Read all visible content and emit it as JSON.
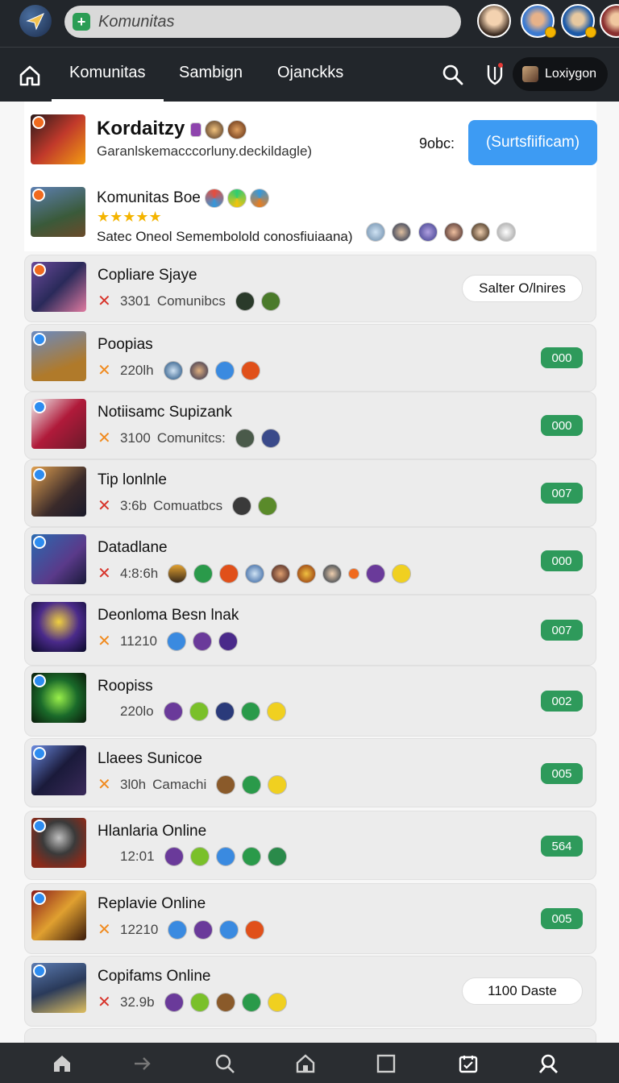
{
  "search": {
    "value": "Komunitas"
  },
  "nav": {
    "tabs": [
      "Komunitas",
      "Sambign",
      "Ojanckks"
    ],
    "account_label": "Loxiygon"
  },
  "header": {
    "title": "Kordaitzy",
    "subtitle": "Garanlskemacccorluny.deckildagle)",
    "label": "9obc:",
    "button": "(Surtsfiificam)"
  },
  "featured": {
    "title": "Komunitas Boe",
    "stars": "★★★★★",
    "subtitle": "Satec Oneol Semembolold conosfiuiaana)"
  },
  "rows": [
    {
      "title": "Copliare Sjaye",
      "mark": "✕",
      "meta": "3301",
      "meta2": "Comunibcs",
      "action": "Salter O/lnires",
      "kind": "pill",
      "mark_color": "red"
    },
    {
      "title": "Poopias",
      "mark": "✕",
      "meta": "220lh",
      "meta2": "",
      "action": "000",
      "kind": "count",
      "mark_color": "orange"
    },
    {
      "title": "Notiisamc Supizank",
      "mark": "✕",
      "meta": "3100",
      "meta2": "Comunitcs:",
      "action": "000",
      "kind": "count",
      "mark_color": "orange"
    },
    {
      "title": "Tip lonlnle",
      "mark": "✕",
      "meta": "3:6b",
      "meta2": "Comuatbcs",
      "action": "007",
      "kind": "count",
      "mark_color": "red"
    },
    {
      "title": "Datadlane",
      "mark": "✕",
      "meta": "4:8:6h",
      "meta2": "",
      "action": "000",
      "kind": "count",
      "mark_color": "red"
    },
    {
      "title": "Deonloma Besn lnak",
      "mark": "✕",
      "meta": "11210",
      "meta2": "",
      "action": "007",
      "kind": "count",
      "mark_color": "orange"
    },
    {
      "title": "Roopiss",
      "mark": "",
      "meta": "220lo",
      "meta2": "",
      "action": "002",
      "kind": "count",
      "mark_color": "orange"
    },
    {
      "title": "Llaees Sunicoe",
      "mark": "✕",
      "meta": "3l0h",
      "meta2": "Camachi",
      "action": "005",
      "kind": "count",
      "mark_color": "orange"
    },
    {
      "title": "Hlanlaria Online",
      "mark": "",
      "meta": "12:01",
      "meta2": "",
      "action": "564",
      "kind": "count",
      "mark_color": "orange"
    },
    {
      "title": "Replavie Online",
      "mark": "✕",
      "meta": "12210",
      "meta2": "",
      "action": "005",
      "kind": "count",
      "mark_color": "orange"
    },
    {
      "title": "Copifams Online",
      "mark": "✕",
      "meta": "32.9b",
      "meta2": "",
      "action": "1100 Daste",
      "kind": "pill",
      "mark_color": "red"
    }
  ],
  "colors": {
    "topbar": "#22262b",
    "accent_blue": "#3d9bf3",
    "count_green": "#2e9a5b",
    "star": "#f4b400"
  }
}
